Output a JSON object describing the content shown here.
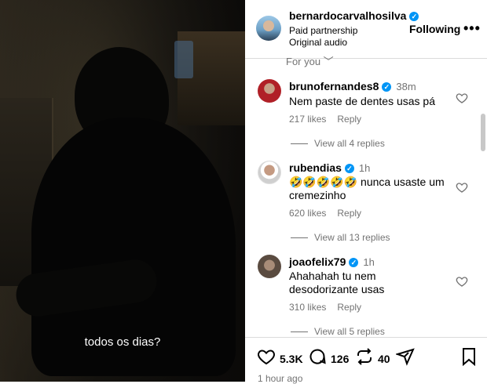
{
  "video": {
    "caption": "todos os dias?"
  },
  "header": {
    "username": "bernardocarvalhosilva",
    "subtitle1": "Paid partnership",
    "subtitle2": "Original audio",
    "follow_label": "Following",
    "more_label": "•••"
  },
  "sort": {
    "label": "For you ﹀"
  },
  "comments": [
    {
      "username": "brunofernandes8",
      "time": "38m",
      "text": "Nem paste de dentes usas pá",
      "likes": "217 likes",
      "reply_label": "Reply",
      "view_replies": "View all 4 replies"
    },
    {
      "username": "rubendias",
      "time": "1h",
      "text": "🤣🤣🤣🤣🤣 nunca usaste um cremezinho",
      "likes": "620 likes",
      "reply_label": "Reply",
      "view_replies": "View all 13 replies"
    },
    {
      "username": "joaofelix79",
      "time": "1h",
      "text": "Ahahahah tu nem desodorizante usas",
      "likes": "310 likes",
      "reply_label": "Reply",
      "view_replies": "View all 5 replies"
    }
  ],
  "actions": {
    "likes": "5.3K",
    "comments": "126",
    "reposts": "40"
  },
  "post_time": "1 hour ago",
  "icons": {
    "like": "heart-icon",
    "comment": "comment-bubble-icon",
    "repost": "repost-icon",
    "share": "send-icon",
    "save": "bookmark-icon",
    "verified": "verified-badge-icon"
  },
  "colors": {
    "verified": "#0095f6",
    "muted": "#737373"
  }
}
